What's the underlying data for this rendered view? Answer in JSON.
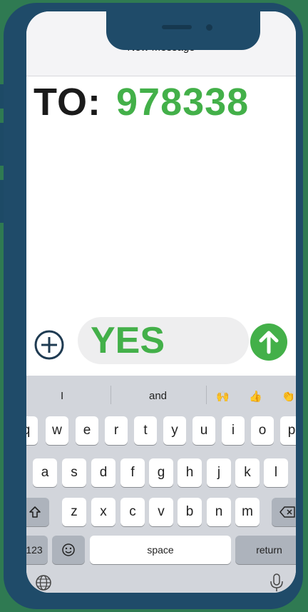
{
  "header": {
    "title": "New Message"
  },
  "recipient": {
    "label": "TO:",
    "number": "978338"
  },
  "compose": {
    "message": "YES"
  },
  "keyboard": {
    "suggestions": [
      "I",
      "and",
      "🙌",
      "👍",
      "👏"
    ],
    "rows": [
      [
        "q",
        "w",
        "e",
        "r",
        "t",
        "y",
        "u",
        "i",
        "o",
        "p"
      ],
      [
        "a",
        "s",
        "d",
        "f",
        "g",
        "h",
        "j",
        "k",
        "l"
      ],
      [
        "z",
        "x",
        "c",
        "v",
        "b",
        "n",
        "m"
      ]
    ],
    "numbers_label": "123",
    "space_label": "space",
    "return_label": "return"
  },
  "colors": {
    "accent": "#43b049",
    "frame": "#1f4b69",
    "background": "#2f7a52"
  },
  "icons": {
    "add": "plus-circle-icon",
    "send": "arrow-up-icon",
    "shift": "shift-icon",
    "delete": "backspace-icon",
    "emoji": "emoji-icon",
    "globe": "globe-icon",
    "mic": "microphone-icon"
  }
}
